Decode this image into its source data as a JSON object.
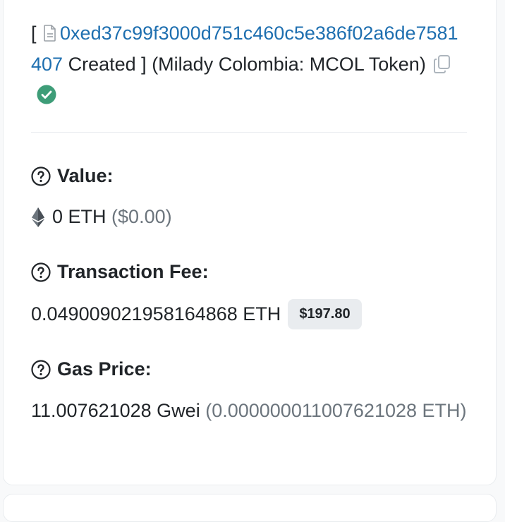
{
  "header": {
    "bracket_open": "[",
    "contract_address": "0xed37c99f3000d751c460c5e386f02a6de7581407",
    "created_label": "Created",
    "bracket_close": "]",
    "token_name": "(Milady Colombia: MCOL Token)"
  },
  "value": {
    "label": "Value:",
    "amount": "0 ETH",
    "usd": "($0.00)"
  },
  "fee": {
    "label": "Transaction Fee:",
    "amount": "0.049009021958164868 ETH",
    "usd_badge": "$197.80"
  },
  "gas": {
    "label": "Gas Price:",
    "gwei": "11.007621028 Gwei",
    "eth": "(0.000000011007621028 ETH)"
  },
  "colors": {
    "link": "#1e6fb0",
    "verified": "#3e9d78",
    "muted": "#6c757d"
  },
  "icons": [
    "document-icon",
    "copy-icon",
    "verified-check-icon",
    "help-icon",
    "ethereum-icon"
  ]
}
